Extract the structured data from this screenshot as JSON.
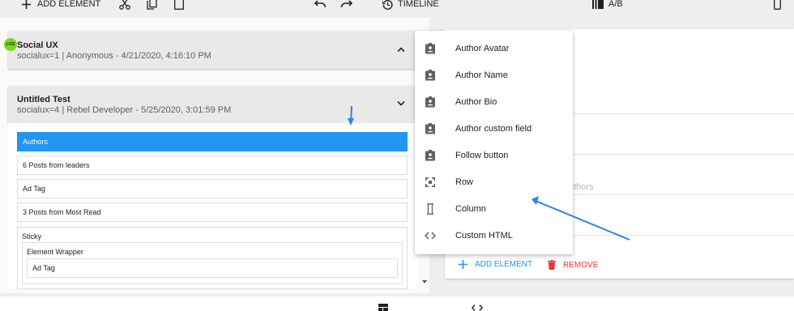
{
  "toolbar": {
    "add_element": "ADD ELEMENT",
    "timeline": "TIMELINE",
    "ab": "A/B"
  },
  "cards": [
    {
      "title": "Social UX",
      "subtitle": "socialux=1 | Anonymous - 4/21/2020, 4:16:10 PM",
      "badge": "LIVE"
    },
    {
      "title": "Untitled Test",
      "subtitle": "socialux=4 | Rebel Developer - 5/25/2020, 3:01:59 PM"
    }
  ],
  "elements": {
    "rows": [
      "Authors",
      "6 Posts from leaders",
      "Ad Tag",
      "3 Posts from Most Read"
    ],
    "sticky": "Sticky",
    "element_wrapper": "Element Wrapper",
    "inner_ad_tag": "Ad Tag"
  },
  "menu": {
    "items": [
      {
        "label": "Author Avatar",
        "icon": "badge-icon"
      },
      {
        "label": "Author Name",
        "icon": "badge-icon"
      },
      {
        "label": "Author Bio",
        "icon": "badge-icon"
      },
      {
        "label": "Author custom field",
        "icon": "badge-icon"
      },
      {
        "label": "Follow button",
        "icon": "badge-icon"
      },
      {
        "label": "Row",
        "icon": "row-icon"
      },
      {
        "label": "Column",
        "icon": "column-icon"
      },
      {
        "label": "Custom HTML",
        "icon": "code-icon"
      }
    ]
  },
  "right_panel": {
    "ghost_text": "uthors",
    "add_element": "ADD ELEMENT",
    "remove": "REMOVE"
  },
  "colors": {
    "accent": "#2196f3",
    "danger": "#e53935",
    "live": "#7ed321"
  }
}
